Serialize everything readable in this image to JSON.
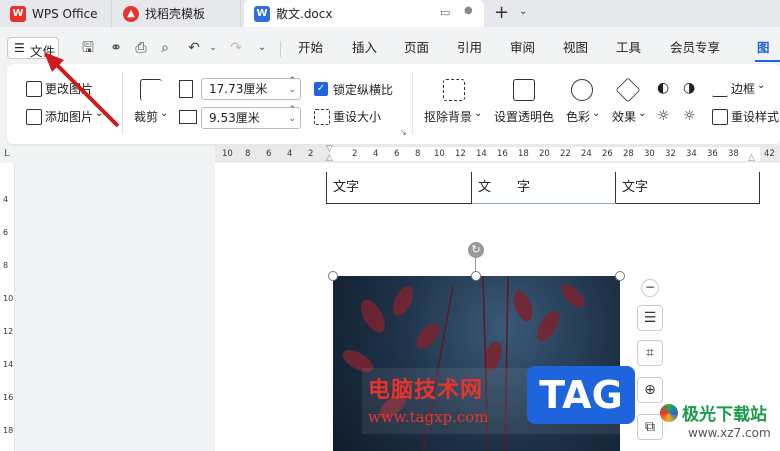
{
  "tabs": {
    "wps": "WPS Office",
    "template": "找稻壳模板",
    "doc": "散文.docx"
  },
  "menu": {
    "file": "文件",
    "items": [
      "开始",
      "插入",
      "页面",
      "引用",
      "审阅",
      "视图",
      "工具",
      "会员专享",
      "图片"
    ]
  },
  "ribbon": {
    "change_picture": "更改图片",
    "add_picture": "添加图片",
    "crop": "裁剪",
    "width": "17.73厘米",
    "height": "9.53厘米",
    "lock_ratio": "锁定纵横比",
    "reset_size": "重设大小",
    "remove_bg": "抠除背景",
    "set_transparent": "设置透明色",
    "color": "色彩",
    "effect": "效果",
    "border": "边框",
    "reset_style": "重设样式"
  },
  "ruler": {
    "h": [
      "10",
      "8",
      "6",
      "4",
      "2",
      "2",
      "2",
      "4",
      "6",
      "8",
      "10",
      "12",
      "14",
      "16",
      "18",
      "20",
      "22",
      "24",
      "26",
      "28",
      "30",
      "32",
      "34",
      "36",
      "38",
      "42"
    ],
    "v": [
      "4",
      "6",
      "8",
      "10",
      "12",
      "14",
      "16",
      "18"
    ]
  },
  "table": [
    "文字",
    "文　　字",
    "文字"
  ],
  "watermark": {
    "title": "电脑技术网",
    "url": "www.tagxp.com",
    "tag": "TAG",
    "site": "极光下载站",
    "site_url": "www.xz7.com"
  },
  "colors": {
    "accent": "#1e64dc",
    "arrow": "#d0191c",
    "wps_red": "#e8332a"
  }
}
